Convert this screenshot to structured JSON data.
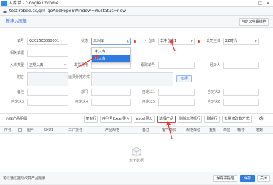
{
  "window": {
    "title": "入库单 - Google Chrome",
    "url": "test.rebee.cc/gm_goAddPopenWindow=Y&status=new",
    "controls": [
      "—",
      "☐",
      "✕"
    ]
  },
  "header": {
    "page_title": "新建入库单",
    "custom_button": "自定义字段维护"
  },
  "form": {
    "order_no_label": "单号",
    "order_no_value": "G202503060001",
    "status_label": "状态",
    "status_value": "未入库",
    "warehouse_label": "仓库",
    "warehouse_value": "华中仓库1",
    "company_label": "公司主体",
    "company_value": "ZZ时代",
    "related_order_label": "相关单据",
    "inbound_type_label": "入库类型",
    "inbound_type_value": "正常入库",
    "shipping_cost_label": "发货费用",
    "tracking_label": "跟踪单号",
    "handler_label": "经办人",
    "remark_label": "附言",
    "fee_label": "运费分摊方式",
    "select_button": "选择",
    "fields": [
      "备注",
      "部门",
      "自定义1",
      "自定义2",
      "自定义3",
      "自定义4",
      "自定义5",
      "自定义6"
    ]
  },
  "status_dropdown": {
    "options": [
      "未入库",
      "已入库"
    ],
    "selected": "已入库"
  },
  "products": {
    "title": "入库产品明细",
    "toolbar": [
      "复制行",
      "序列号Excel导入",
      "excel导入",
      "选择产品",
      "删除未选择行",
      "删除行",
      "批量修改数方式"
    ],
    "columns": [
      "序号",
      "图片",
      "SKU1",
      "工厂货号",
      "产品规格",
      "备注",
      "客户单价",
      "规格单位",
      "重量",
      "单位",
      "箱号",
      "箱数"
    ],
    "empty_text": "暂无数据"
  },
  "footer": {
    "note": "可以通过拖动改变产品顺序",
    "buttons": [
      "保存并提醒",
      "保存",
      "关闭"
    ]
  },
  "colors": {
    "accent": "#2f7be0",
    "required": "#e53935",
    "annotation": "#e53935"
  }
}
